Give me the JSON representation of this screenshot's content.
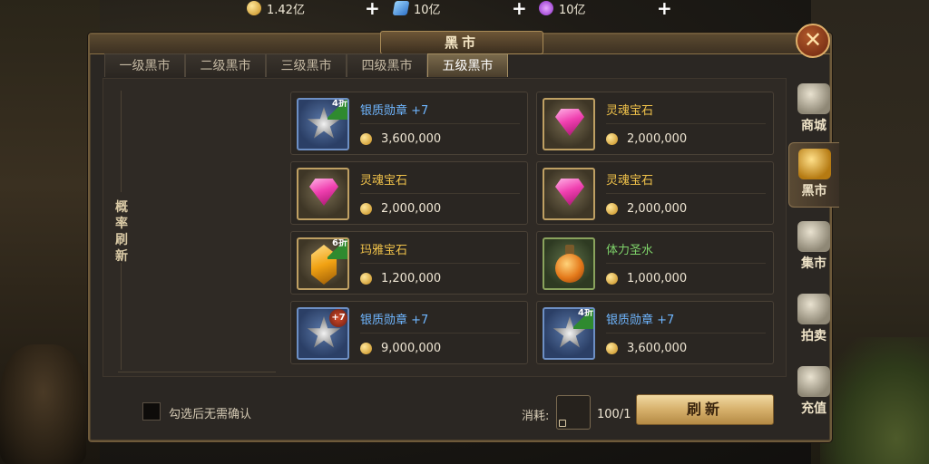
{
  "resources": [
    {
      "icon": "gold-coin-icon",
      "value": "1.42亿"
    },
    {
      "icon": "blue-crystal-icon",
      "value": "10亿"
    },
    {
      "icon": "purple-orb-icon",
      "value": "10亿"
    }
  ],
  "panel": {
    "title": "黑市"
  },
  "tabs": [
    "一级黑市",
    "二级黑市",
    "三级黑市",
    "四级黑市",
    "五级黑市"
  ],
  "active_tab": "五级黑市",
  "left": {
    "refresh_label": "概率刷新"
  },
  "items": [
    {
      "name": "银质勋章 +7",
      "price": "3,600,000",
      "rarity": "blue",
      "art": "medal",
      "badge": "4折"
    },
    {
      "name": "灵魂宝石",
      "price": "2,000,000",
      "rarity": "gold",
      "art": "gem",
      "badge": ""
    },
    {
      "name": "灵魂宝石",
      "price": "2,000,000",
      "rarity": "gold",
      "art": "gem",
      "badge": ""
    },
    {
      "name": "灵魂宝石",
      "price": "2,000,000",
      "rarity": "gold",
      "art": "gem",
      "badge": ""
    },
    {
      "name": "玛雅宝石",
      "price": "1,200,000",
      "rarity": "gold",
      "art": "topaz",
      "badge": "6折"
    },
    {
      "name": "体力圣水",
      "price": "1,000,000",
      "rarity": "green",
      "art": "potion",
      "badge": ""
    },
    {
      "name": "银质勋章 +7",
      "price": "9,000,000",
      "rarity": "blue",
      "art": "medal",
      "badge": "+7"
    },
    {
      "name": "银质勋章 +7",
      "price": "3,600,000",
      "rarity": "blue",
      "art": "medal",
      "badge": "4折"
    }
  ],
  "bottom": {
    "checkbox_label": "勾选后无需确认",
    "cost_label": "消耗:",
    "cost_count": "100/1",
    "refresh_button": "刷新"
  },
  "sidenav": [
    {
      "label": "商城",
      "icon": "money-bag-icon"
    },
    {
      "label": "黑市",
      "icon": "black-market-icon",
      "active": true
    },
    {
      "label": "集市",
      "icon": "coins-stack-icon"
    },
    {
      "label": "拍卖",
      "icon": "auction-gavel-icon"
    },
    {
      "label": "充值",
      "icon": "diamond-icon"
    }
  ],
  "colors": {
    "accent_gold": "#d6b06b",
    "blue_rarity": "#6fb6ff",
    "gold_rarity": "#f0c24a",
    "green_rarity": "#7fd36a"
  }
}
